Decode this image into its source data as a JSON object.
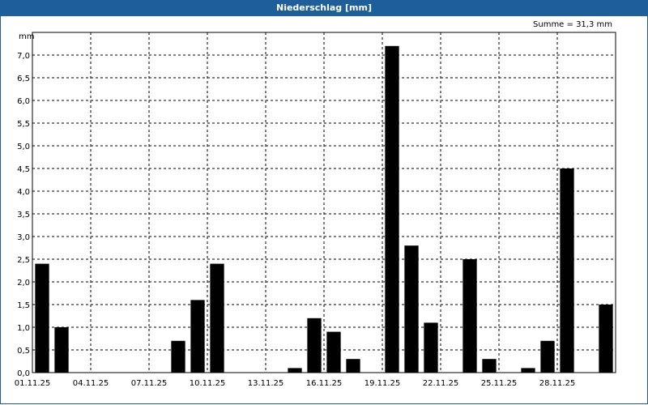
{
  "window": {
    "title": "Niederschlag [mm]"
  },
  "summary": "Summe = 31,3 mm",
  "colors": {
    "titlebar": "#1f5f99",
    "bar": "#000000",
    "grid": "#000000"
  },
  "chart_data": {
    "type": "bar",
    "title": "Niederschlag [mm]",
    "ylabel": "mm",
    "ylim": [
      0,
      7.5
    ],
    "grid": true,
    "ytick_values": [
      0,
      0.5,
      1,
      1.5,
      2,
      2.5,
      3,
      3.5,
      4,
      4.5,
      5,
      5.5,
      6,
      6.5,
      7
    ],
    "yticks": [
      "0,0",
      "0,5",
      "1,0",
      "1,5",
      "2,0",
      "2,5",
      "3,0",
      "3,5",
      "4,0",
      "4,5",
      "5,0",
      "5,5",
      "6,0",
      "6,5",
      "7,0"
    ],
    "xticks": [
      "01.11.25",
      "04.11.25",
      "07.11.25",
      "10.11.25",
      "13.11.25",
      "16.11.25",
      "19.11.25",
      "22.11.25",
      "25.11.25",
      "28.11.25"
    ],
    "categories": [
      "01.11.25",
      "02.11.25",
      "03.11.25",
      "04.11.25",
      "05.11.25",
      "06.11.25",
      "07.11.25",
      "08.11.25",
      "09.11.25",
      "10.11.25",
      "11.11.25",
      "12.11.25",
      "13.11.25",
      "14.11.25",
      "15.11.25",
      "16.11.25",
      "17.11.25",
      "18.11.25",
      "19.11.25",
      "20.11.25",
      "21.11.25",
      "22.11.25",
      "23.11.25",
      "24.11.25",
      "25.11.25",
      "26.11.25",
      "27.11.25",
      "28.11.25",
      "29.11.25",
      "30.11.25"
    ],
    "values": [
      2.4,
      1.0,
      0,
      0,
      0,
      0,
      0,
      0.7,
      1.6,
      2.4,
      0,
      0,
      0,
      0.1,
      1.2,
      0.9,
      0.3,
      0,
      7.2,
      2.8,
      1.1,
      0,
      2.5,
      0.3,
      0,
      0.1,
      0.7,
      4.5,
      0,
      1.5
    ]
  }
}
